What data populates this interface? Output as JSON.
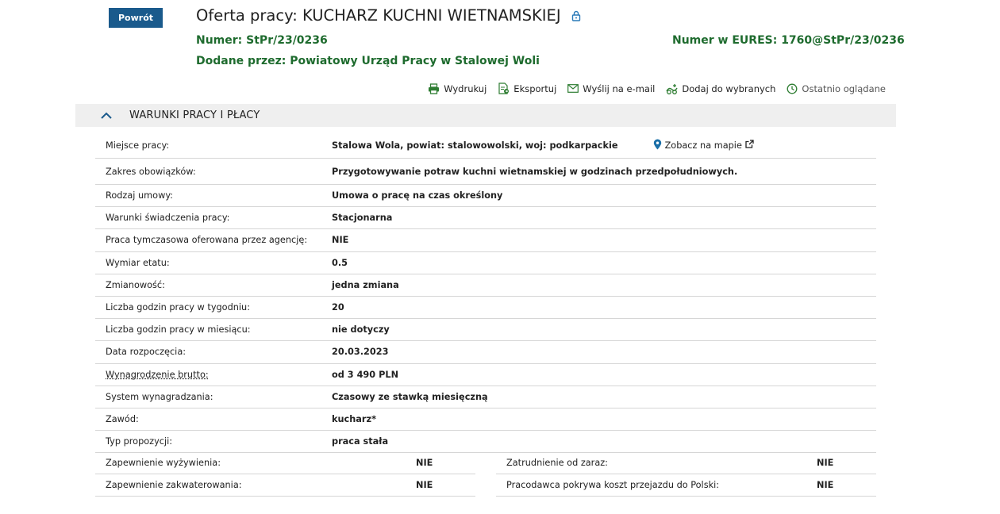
{
  "back_label": "Powrót",
  "title": "Oferta pracy: KUCHARZ KUCHNI WIETNAMSKIEJ",
  "numer_label": "Numer: ",
  "numer_value": "StPr/23/0236",
  "eures_label": "Numer w EURES: ",
  "eures_value": "1760@StPr/23/0236",
  "dodane_label": "Dodane przez: ",
  "dodane_value": "Powiatowy Urząd Pracy w Stalowej Woli",
  "toolbar": {
    "print": "Wydrukuj",
    "export": "Eksportuj",
    "email": "Wyślij na e-mail",
    "favorite": "Dodaj do wybranych",
    "recent": "Ostatnio oglądane"
  },
  "section_title": "WARUNKI PRACY I PŁACY",
  "map_link": "Zobacz na mapie",
  "rows": [
    {
      "label": "Miejsce pracy:",
      "value": "Stalowa Wola, powiat: stalowowolski, woj: podkarpackie"
    },
    {
      "label": "Zakres obowiązków:",
      "value": "Przygotowywanie potraw kuchni wietnamskiej w godzinach przedpołudniowych."
    },
    {
      "label": "Rodzaj umowy:",
      "value": "Umowa o pracę na czas określony"
    },
    {
      "label": "Warunki świadczenia pracy:",
      "value": "Stacjonarna"
    },
    {
      "label": "Praca tymczasowa oferowana przez agencję:",
      "value": "NIE"
    },
    {
      "label": "Wymiar etatu:",
      "value": "0.5"
    },
    {
      "label": "Zmianowość:",
      "value": "jedna zmiana"
    },
    {
      "label": "Liczba godzin pracy w tygodniu:",
      "value": "20"
    },
    {
      "label": "Liczba godzin pracy w miesiącu:",
      "value": "nie dotyczy"
    },
    {
      "label": "Data rozpoczęcia:",
      "value": "20.03.2023"
    },
    {
      "label": "Wynagrodzenie brutto:",
      "value": "od 3 490 PLN"
    },
    {
      "label": "System wynagradzania:",
      "value": "Czasowy ze stawką miesięczną"
    },
    {
      "label": "Zawód:",
      "value": "kucharz*"
    },
    {
      "label": "Typ propozycji:",
      "value": "praca stała"
    }
  ],
  "half_rows": [
    {
      "left_label": "Zapewnienie wyżywienia:",
      "left_value": "NIE",
      "right_label": "Zatrudnienie od zaraz:",
      "right_value": "NIE"
    },
    {
      "left_label": "Zapewnienie zakwaterowania:",
      "left_value": "NIE",
      "right_label": "Pracodawca pokrywa koszt przejazdu do Polski:",
      "right_value": "NIE"
    }
  ],
  "colors": {
    "accent_blue": "#1a5a8c",
    "green": "#1e6b2e",
    "section_bg": "#efefef"
  }
}
